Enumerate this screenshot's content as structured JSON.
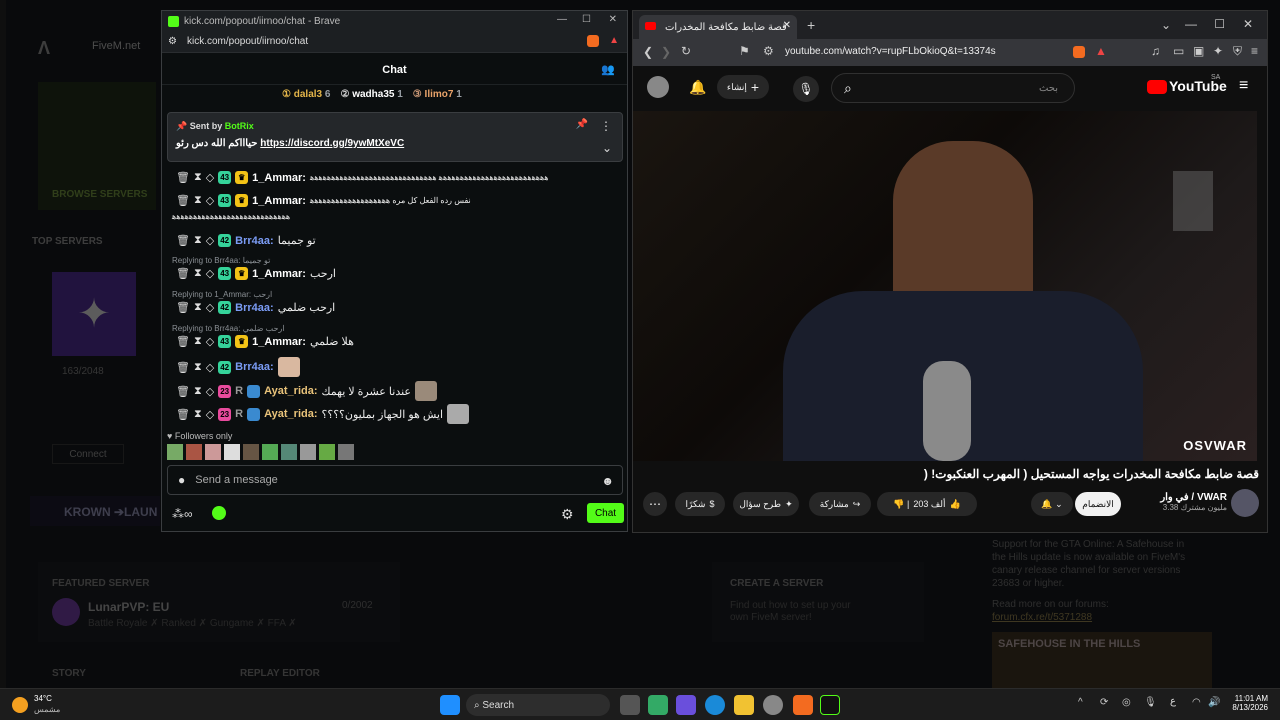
{
  "fivem": {
    "nav_label": "FiveM.net",
    "browse": "BROWSE SERVERS",
    "top_servers": "TOP SERVERS",
    "player_count": "163/2048",
    "connect": "Connect",
    "krown": "KROWN ➔LAUN",
    "featured": "FEATURED SERVER",
    "lunar": "LunarPVP: EU",
    "lunar_count": "0/2002",
    "lunar_tags": "Battle Royale ✗ Ranked ✗ Gungame ✗ FFA ✗",
    "create": "CREATE A SERVER",
    "create_desc1": "Find out how to set up your",
    "create_desc2": "own FiveM server!",
    "story": "STORY",
    "replay": "REPLAY EDITOR",
    "news1": "Support for the GTA Online: A Safehouse in",
    "news2": "the Hills update is now available on FiveM's",
    "news3": "canary release channel for server versions",
    "news4": "23683 or higher.",
    "forums": "Read more on our forums:",
    "forum_link": "forum.cfx.re/t/5371288",
    "thumb": "SAFEHOUSE IN THE HILLS"
  },
  "kick": {
    "window_title": "kick.com/popout/iirnoo/chat - Brave",
    "url": "kick.com/popout/iirnoo/chat",
    "chat_title": "Chat",
    "top": [
      {
        "name": "dalal3",
        "n": "6"
      },
      {
        "name": "wadha35",
        "n": "1"
      },
      {
        "name": "Ilimo7",
        "n": "1"
      }
    ],
    "pinned_sent_by": "Sent by",
    "pinned_bot": "BotRix",
    "pinned_text": "حياااكم الله دس رئو",
    "pinned_link": "https://discord.gg/9ywMtXeVC",
    "messages": [
      {
        "user": "1_Ammar:",
        "text": "ﻫﻫﻫﻫﻫﻫﻫﻫﻫﻫﻫﻫﻫﻫﻫﻫﻫﻫﻫﻫﻫﻫﻫﻫﻫﻫ ﻫﻫﻫﻫﻫﻫﻫﻫﻫﻫﻫﻫﻫﻫﻫﻫﻫﻫﻫﻫﻫﻫﻫﻫﻫﻫﻫﻫﻫﻫ",
        "badge": "43"
      },
      {
        "user": "1_Ammar:",
        "text": "نفس رده الفعل كل مره ﻫﻫﻫﻫﻫﻫﻫﻫﻫﻫﻫﻫﻫﻫﻫﻫﻫﻫﻫ",
        "badge": "43",
        "cont": "ﻫﻫﻫﻫﻫﻫﻫﻫﻫﻫﻫﻫﻫﻫﻫﻫﻫﻫﻫﻫﻫﻫﻫﻫﻫﻫﻫﻫ"
      },
      {
        "user": "Brr4aa:",
        "text": "تو جميما",
        "badge": "42"
      },
      {
        "reply": "Replying to Brr4aa: تو جميما",
        "user": "1_Ammar:",
        "text": "ارحب",
        "badge": "43"
      },
      {
        "reply": "Replying to 1_Ammar: ارحب",
        "user": "Brr4aa:",
        "text": "ارحب ضلمي",
        "badge": "42"
      },
      {
        "reply": "Replying to Brr4aa: ارحب ضلمي",
        "user": "1_Ammar:",
        "text": "هلا ضلمي",
        "badge": "43"
      },
      {
        "user": "Brr4aa:",
        "text": "",
        "badge": "42"
      },
      {
        "user": "Ayat_rida:",
        "text": "عندنا عشرة لا يهمك",
        "badge": "23"
      },
      {
        "user": "Ayat_rida:",
        "text": "ايش هو الجهاز بمليون؟؟؟؟",
        "badge": "23"
      }
    ],
    "followers_only": "Followers only",
    "send_placeholder": "Send a message",
    "chat_button": "Chat"
  },
  "youtube": {
    "tab_title": "قصة ضابط مكافحة المخدرات",
    "url": "youtube.com/watch?v=rupFLbOkioQ&t=13374s",
    "search_placeholder": "بحث",
    "create_label": "إنشاء",
    "logo": "YouTube",
    "logo_sup": "SA",
    "video_title": "قصة ضابط مكافحة المخدرات يواجه المستحيل ( المهرب العنكبوت! (",
    "channel": "في وار / VWAR",
    "subs": "3.38 مليون مشترك",
    "subscribe": "الانضمام",
    "likes": "203 ألف",
    "share": "مشاركة",
    "ask": "طرح سؤال",
    "thanks": "شكرًا",
    "watermark": "OSVWAR"
  },
  "taskbar": {
    "weather_temp": "34°C",
    "weather_desc": "مشمس",
    "search": "Search",
    "time": "11:01 AM",
    "date": "8/13/2026",
    "lang": "ع"
  }
}
